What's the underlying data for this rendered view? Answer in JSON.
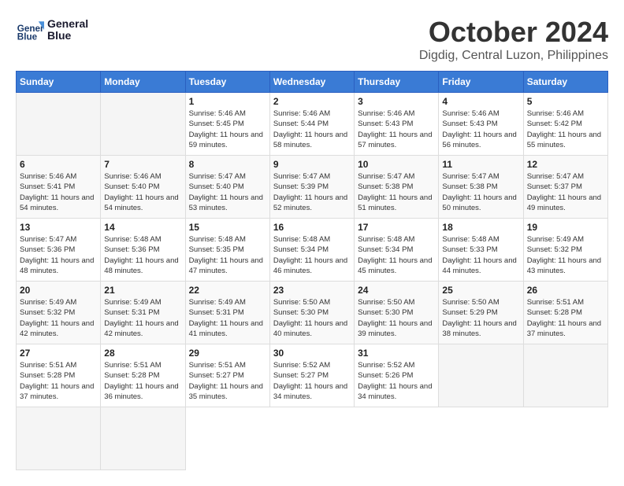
{
  "logo": {
    "line1": "General",
    "line2": "Blue"
  },
  "title": "October 2024",
  "location": "Digdig, Central Luzon, Philippines",
  "weekdays": [
    "Sunday",
    "Monday",
    "Tuesday",
    "Wednesday",
    "Thursday",
    "Friday",
    "Saturday"
  ],
  "days": [
    {
      "num": "",
      "info": ""
    },
    {
      "num": "",
      "info": ""
    },
    {
      "num": "1",
      "info": "Sunrise: 5:46 AM\nSunset: 5:45 PM\nDaylight: 11 hours and 59 minutes."
    },
    {
      "num": "2",
      "info": "Sunrise: 5:46 AM\nSunset: 5:44 PM\nDaylight: 11 hours and 58 minutes."
    },
    {
      "num": "3",
      "info": "Sunrise: 5:46 AM\nSunset: 5:43 PM\nDaylight: 11 hours and 57 minutes."
    },
    {
      "num": "4",
      "info": "Sunrise: 5:46 AM\nSunset: 5:43 PM\nDaylight: 11 hours and 56 minutes."
    },
    {
      "num": "5",
      "info": "Sunrise: 5:46 AM\nSunset: 5:42 PM\nDaylight: 11 hours and 55 minutes."
    },
    {
      "num": "6",
      "info": "Sunrise: 5:46 AM\nSunset: 5:41 PM\nDaylight: 11 hours and 54 minutes."
    },
    {
      "num": "7",
      "info": "Sunrise: 5:46 AM\nSunset: 5:40 PM\nDaylight: 11 hours and 54 minutes."
    },
    {
      "num": "8",
      "info": "Sunrise: 5:47 AM\nSunset: 5:40 PM\nDaylight: 11 hours and 53 minutes."
    },
    {
      "num": "9",
      "info": "Sunrise: 5:47 AM\nSunset: 5:39 PM\nDaylight: 11 hours and 52 minutes."
    },
    {
      "num": "10",
      "info": "Sunrise: 5:47 AM\nSunset: 5:38 PM\nDaylight: 11 hours and 51 minutes."
    },
    {
      "num": "11",
      "info": "Sunrise: 5:47 AM\nSunset: 5:38 PM\nDaylight: 11 hours and 50 minutes."
    },
    {
      "num": "12",
      "info": "Sunrise: 5:47 AM\nSunset: 5:37 PM\nDaylight: 11 hours and 49 minutes."
    },
    {
      "num": "13",
      "info": "Sunrise: 5:47 AM\nSunset: 5:36 PM\nDaylight: 11 hours and 48 minutes."
    },
    {
      "num": "14",
      "info": "Sunrise: 5:48 AM\nSunset: 5:36 PM\nDaylight: 11 hours and 48 minutes."
    },
    {
      "num": "15",
      "info": "Sunrise: 5:48 AM\nSunset: 5:35 PM\nDaylight: 11 hours and 47 minutes."
    },
    {
      "num": "16",
      "info": "Sunrise: 5:48 AM\nSunset: 5:34 PM\nDaylight: 11 hours and 46 minutes."
    },
    {
      "num": "17",
      "info": "Sunrise: 5:48 AM\nSunset: 5:34 PM\nDaylight: 11 hours and 45 minutes."
    },
    {
      "num": "18",
      "info": "Sunrise: 5:48 AM\nSunset: 5:33 PM\nDaylight: 11 hours and 44 minutes."
    },
    {
      "num": "19",
      "info": "Sunrise: 5:49 AM\nSunset: 5:32 PM\nDaylight: 11 hours and 43 minutes."
    },
    {
      "num": "20",
      "info": "Sunrise: 5:49 AM\nSunset: 5:32 PM\nDaylight: 11 hours and 42 minutes."
    },
    {
      "num": "21",
      "info": "Sunrise: 5:49 AM\nSunset: 5:31 PM\nDaylight: 11 hours and 42 minutes."
    },
    {
      "num": "22",
      "info": "Sunrise: 5:49 AM\nSunset: 5:31 PM\nDaylight: 11 hours and 41 minutes."
    },
    {
      "num": "23",
      "info": "Sunrise: 5:50 AM\nSunset: 5:30 PM\nDaylight: 11 hours and 40 minutes."
    },
    {
      "num": "24",
      "info": "Sunrise: 5:50 AM\nSunset: 5:30 PM\nDaylight: 11 hours and 39 minutes."
    },
    {
      "num": "25",
      "info": "Sunrise: 5:50 AM\nSunset: 5:29 PM\nDaylight: 11 hours and 38 minutes."
    },
    {
      "num": "26",
      "info": "Sunrise: 5:51 AM\nSunset: 5:28 PM\nDaylight: 11 hours and 37 minutes."
    },
    {
      "num": "27",
      "info": "Sunrise: 5:51 AM\nSunset: 5:28 PM\nDaylight: 11 hours and 37 minutes."
    },
    {
      "num": "28",
      "info": "Sunrise: 5:51 AM\nSunset: 5:28 PM\nDaylight: 11 hours and 36 minutes."
    },
    {
      "num": "29",
      "info": "Sunrise: 5:51 AM\nSunset: 5:27 PM\nDaylight: 11 hours and 35 minutes."
    },
    {
      "num": "30",
      "info": "Sunrise: 5:52 AM\nSunset: 5:27 PM\nDaylight: 11 hours and 34 minutes."
    },
    {
      "num": "31",
      "info": "Sunrise: 5:52 AM\nSunset: 5:26 PM\nDaylight: 11 hours and 34 minutes."
    },
    {
      "num": "",
      "info": ""
    },
    {
      "num": "",
      "info": ""
    },
    {
      "num": "",
      "info": ""
    },
    {
      "num": "",
      "info": ""
    }
  ]
}
